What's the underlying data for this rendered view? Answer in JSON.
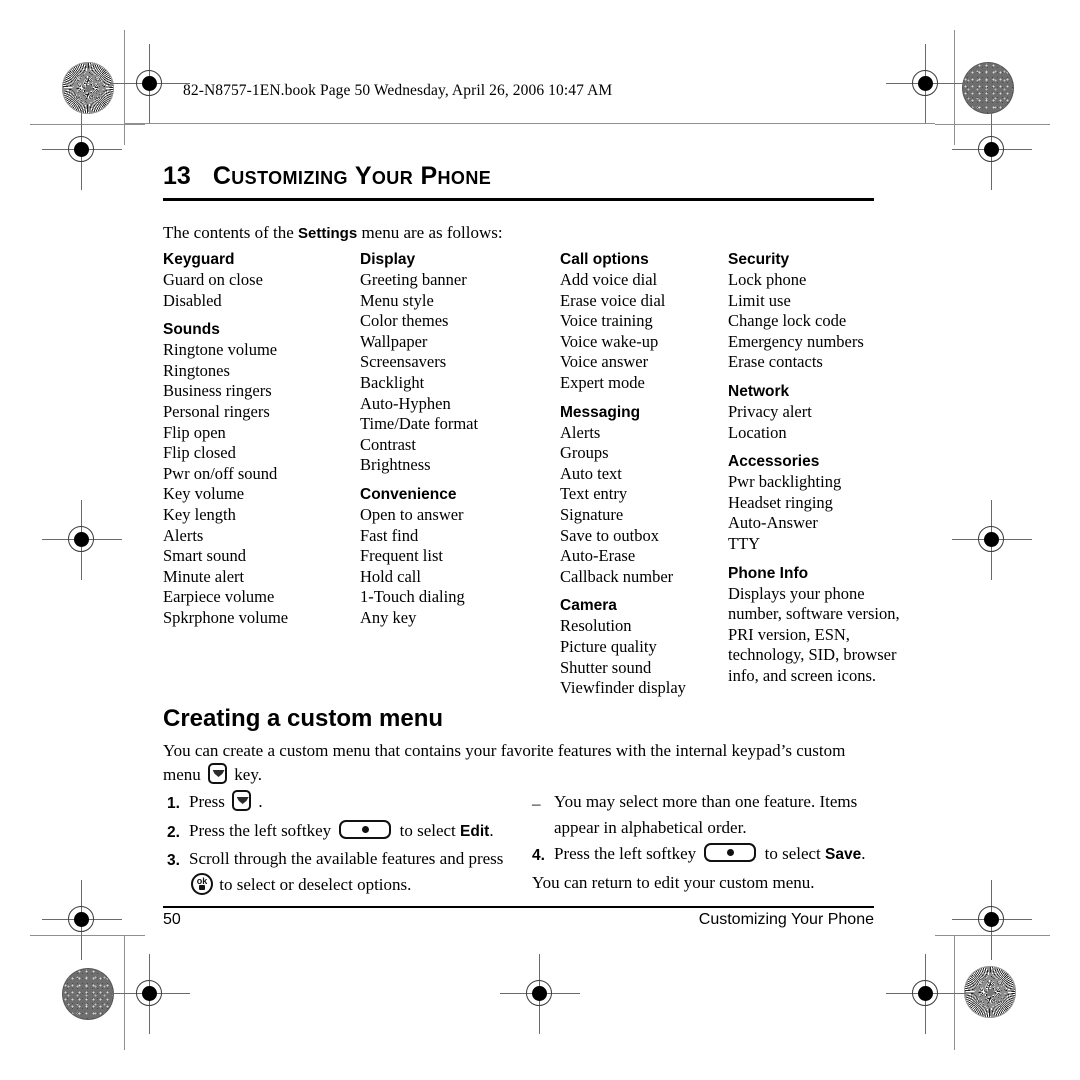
{
  "running_head": "82-N8757-1EN.book  Page 50  Wednesday, April 26, 2006  10:47 AM",
  "chapter": {
    "number": "13",
    "title": "Customizing Your Phone"
  },
  "intro": {
    "before": "The contents of the ",
    "bold": "Settings",
    "after": " menu are as follows:"
  },
  "settings_columns": [
    {
      "groups": [
        {
          "heading": "Keyguard",
          "items": [
            "Guard on close",
            "Disabled"
          ]
        },
        {
          "heading": "Sounds",
          "items": [
            "Ringtone volume",
            "Ringtones",
            "Business ringers",
            "Personal ringers",
            "Flip open",
            "Flip closed",
            "Pwr on/off sound",
            "Key volume",
            "Key length",
            "Alerts",
            "Smart sound",
            "Minute alert",
            "Earpiece volume",
            "Spkrphone volume"
          ]
        }
      ]
    },
    {
      "groups": [
        {
          "heading": "Display",
          "items": [
            "Greeting banner",
            "Menu style",
            "Color themes",
            "Wallpaper",
            "Screensavers",
            "Backlight",
            "Auto-Hyphen",
            "Time/Date format",
            "Contrast",
            "Brightness"
          ]
        },
        {
          "heading": "Convenience",
          "items": [
            "Open to answer",
            "Fast find",
            "Frequent list",
            "Hold call",
            "1-Touch dialing",
            "Any key"
          ]
        }
      ]
    },
    {
      "groups": [
        {
          "heading": "Call options",
          "items": [
            "Add voice dial",
            "Erase voice dial",
            "Voice training",
            "Voice wake-up",
            "Voice answer",
            "Expert mode"
          ]
        },
        {
          "heading": "Messaging",
          "items": [
            "Alerts",
            "Groups",
            "Auto text",
            "Text entry",
            "Signature",
            "Save to outbox",
            "Auto-Erase",
            "Callback number"
          ]
        },
        {
          "heading": "Camera",
          "items": [
            "Resolution",
            "Picture quality",
            "Shutter sound",
            "Viewfinder display"
          ]
        }
      ]
    },
    {
      "groups": [
        {
          "heading": "Security",
          "items": [
            "Lock phone",
            "Limit use",
            "Change lock code",
            "Emergency numbers",
            "Erase contacts"
          ]
        },
        {
          "heading": "Network",
          "items": [
            "Privacy alert",
            "Location"
          ]
        },
        {
          "heading": "Accessories",
          "items": [
            "Pwr backlighting",
            "Headset ringing",
            "Auto-Answer",
            "TTY"
          ]
        },
        {
          "heading": "Phone Info",
          "paragraph": "Displays your phone number, software version, PRI version, ESN, technology, SID, browser info, and screen icons."
        }
      ]
    }
  ],
  "section": {
    "heading": "Creating a custom menu",
    "lead_before": "You can create a custom menu that contains your favorite features with the internal keypad’s custom menu ",
    "lead_after": " key."
  },
  "steps_left": [
    {
      "marker": "1.",
      "before": "Press ",
      "icon": "custom-menu-key-icon",
      "after": " ."
    },
    {
      "marker": "2.",
      "before": "Press the left softkey ",
      "icon": "softkey-icon",
      "mid": " to select ",
      "bold": "Edit",
      "after": "."
    },
    {
      "marker": "3.",
      "before": "Scroll through the available features and press ",
      "icon": "ok-key-icon",
      "after": " to select or deselect options."
    }
  ],
  "steps_right": [
    {
      "marker": "–",
      "text": "You may select more than one feature. Items appear in alphabetical order."
    },
    {
      "marker": "4.",
      "before": "Press the left softkey ",
      "icon": "softkey-icon",
      "mid": " to select ",
      "bold": "Save",
      "after": "."
    },
    {
      "marker": "",
      "text": "You can return to edit your custom menu."
    }
  ],
  "footer": {
    "page_number": "50",
    "section_title": "Customizing Your Phone"
  },
  "key_labels": {
    "ok": "ok"
  }
}
